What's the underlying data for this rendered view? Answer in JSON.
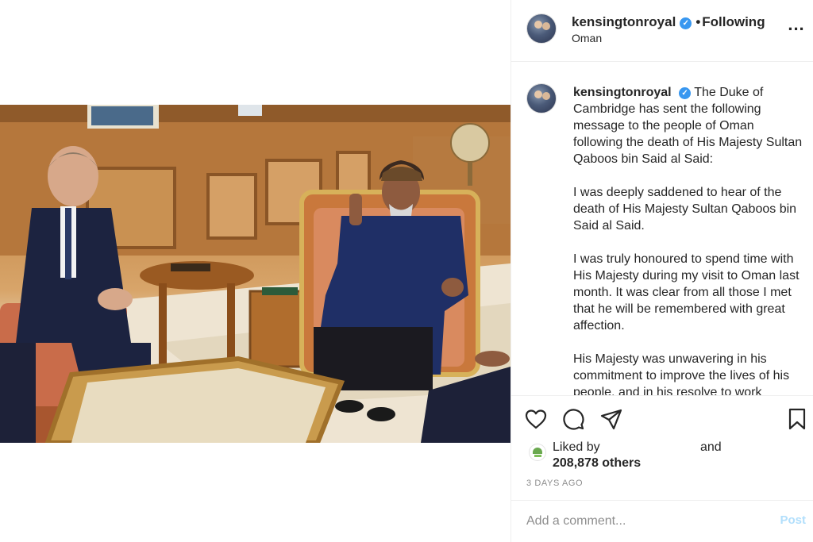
{
  "header": {
    "username": "kensingtonroyal",
    "verified_mark": "✓",
    "separator": "•",
    "following_label": "Following",
    "location": "Oman",
    "more_label": "..."
  },
  "caption": {
    "username": "kensingtonroyal",
    "paragraphs": [
      "The Duke of Cambridge has sent the following message to the people of Oman following the death of His Majesty Sultan Qaboos bin Said al Said:",
      "I was deeply saddened to hear of the death of His Majesty Sultan Qaboos bin Said al Said.",
      "I was truly honoured to spend time with His Majesty during my visit to Oman last month. It was clear from all those I met that he will be remembered with great affection.",
      "His Majesty was unwavering in his commitment to improve the lives of his people, and in his resolve to work"
    ]
  },
  "actions": {
    "icons": [
      "heart-icon",
      "comment-icon",
      "share-icon",
      "bookmark-icon"
    ],
    "liked_by_label": "Liked by",
    "and_label": "and",
    "likes_count": "208,878 others",
    "timestamp": "3 DAYS AGO"
  },
  "comment_form": {
    "placeholder": "Add a comment...",
    "post_label": "Post"
  },
  "colors": {
    "verified": "#3897f0",
    "post_disabled": "#b2dffc",
    "muted_text": "#8e8e8e",
    "border": "#efefef"
  }
}
